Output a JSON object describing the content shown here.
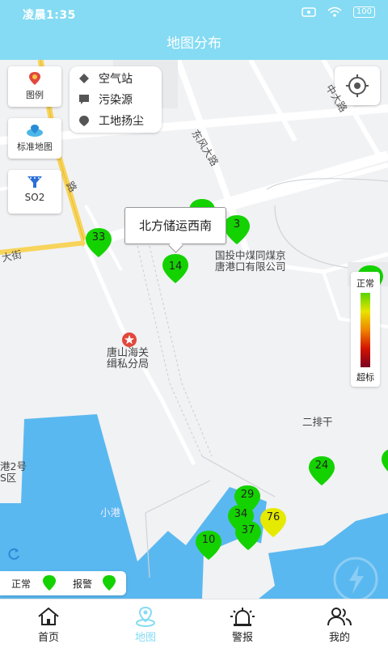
{
  "status_bar": {
    "time": "凌晨1:35",
    "battery": "100"
  },
  "header": {
    "title": "地图分布"
  },
  "left_panels": [
    {
      "label": "图例",
      "icon": "legend-pin-icon"
    },
    {
      "label": "标准地图",
      "icon": "map-layer-icon"
    },
    {
      "label": "SO2",
      "icon": "pollutant-filter-icon"
    }
  ],
  "legend": [
    {
      "label": "空气站",
      "icon": "diamond-icon"
    },
    {
      "label": "污染源",
      "icon": "speech-bubble-icon"
    },
    {
      "label": "工地扬尘",
      "icon": "drop-pin-icon"
    }
  ],
  "callout": {
    "text": "北方储运西南"
  },
  "markers": [
    {
      "value": "33",
      "color": "#14d200"
    },
    {
      "value": "3",
      "color": "#14d200"
    },
    {
      "value": "14",
      "color": "#14d200"
    },
    {
      "value": "24",
      "color": "#14d200"
    },
    {
      "value": "29",
      "color": "#14d200"
    },
    {
      "value": "34",
      "color": "#14d200"
    },
    {
      "value": "76",
      "color": "#e6ea00"
    },
    {
      "value": "37",
      "color": "#14d200"
    },
    {
      "value": "10",
      "color": "#14d200"
    },
    {
      "value": "",
      "color": "#14d200"
    },
    {
      "value": "",
      "color": "#14d200"
    },
    {
      "value": "",
      "color": "#14d200"
    }
  ],
  "map_labels": {
    "company": [
      "国投中煤同煤京",
      "唐港口有限公司"
    ],
    "customs": [
      "唐山海关",
      "缉私分局"
    ],
    "road_dongfeng": "东风大路",
    "road_zhongda": "中大路",
    "road_left": "大街",
    "er_pai_gan": "二排干",
    "xiao_gang": "小港",
    "port_area": [
      "港2号",
      "S区"
    ],
    "road_partial": "路"
  },
  "scale": {
    "top": "正常",
    "bottom": "超标"
  },
  "status_legend": {
    "normal": "正常",
    "alarm": "报警",
    "normal_color": "#14d200",
    "alarm_color": "#14d200"
  },
  "tabs": [
    {
      "label": "首页",
      "icon": "home-icon",
      "active": false
    },
    {
      "label": "地图",
      "icon": "map-pin-icon",
      "active": true
    },
    {
      "label": "警报",
      "icon": "alarm-light-icon",
      "active": false
    },
    {
      "label": "我的",
      "icon": "users-icon",
      "active": false
    }
  ],
  "colors": {
    "header_bg": "#84dbf3",
    "water": "#5ab8f0",
    "accent": "#84dbf3"
  }
}
